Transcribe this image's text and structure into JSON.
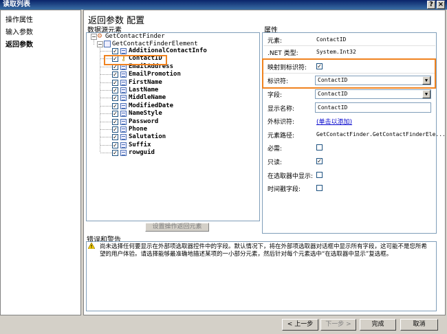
{
  "window": {
    "title": "读取列表",
    "help": "?",
    "close": "×"
  },
  "nav": {
    "items": [
      "操作属性",
      "输入参数",
      "返回参数"
    ],
    "selected": 2
  },
  "main": {
    "title": "返回参数 配置",
    "tree_label": "数据源元素",
    "tree": {
      "root": "GetContactFinder",
      "element": "GetContactFinderElement",
      "fields": [
        "AdditionalContactInfo",
        "ContactID",
        "EmailAddress",
        "EmailPromotion",
        "FirstName",
        "LastName",
        "MiddleName",
        "ModifiedDate",
        "NameStyle",
        "Password",
        "Phone",
        "Salutation",
        "Suffix",
        "rowguid"
      ]
    },
    "return_button": "设置操作返回元素",
    "props_label": "属性",
    "props": {
      "element_label": "元素:",
      "element_value": "ContactID",
      "nettype_label": ".NET 类型:",
      "nettype_value": "System.Int32",
      "map_label": "映射到标识符:",
      "identifier_label": "标识符:",
      "identifier_value": "ContactID",
      "field_label": "字段:",
      "field_value": "ContactID",
      "display_label": "显示名称:",
      "display_value": "ContactID",
      "foreign_label": "外标识符:",
      "foreign_value": "(单击以添加)",
      "path_label": "元素路径:",
      "path_value": "GetContactFinder.GetContactFinderEle...",
      "required_label": "必需:",
      "readonly_label": "只读:",
      "showpicker_label": "在选取器中显示:",
      "timestamp_label": "时间戳字段:"
    },
    "errors_label": "错误和警告",
    "warning_lines": [
      "尚未选择任何要显示在外部项选取器控件中的字段。默认情况下，将在外部项选取器对话框中显示所有字段，这可能不是您所希",
      "望的用户体验。请选择能够最准确地描述某项的一小部分元素，然后针对每个元素选中“在选取器中显示”复选框。"
    ]
  },
  "buttons": {
    "back": "< 上一步",
    "next": "下一步 >",
    "finish": "完成",
    "cancel": "取消"
  },
  "colors": {
    "highlight": "#f0821e",
    "link": "#0000cc"
  }
}
